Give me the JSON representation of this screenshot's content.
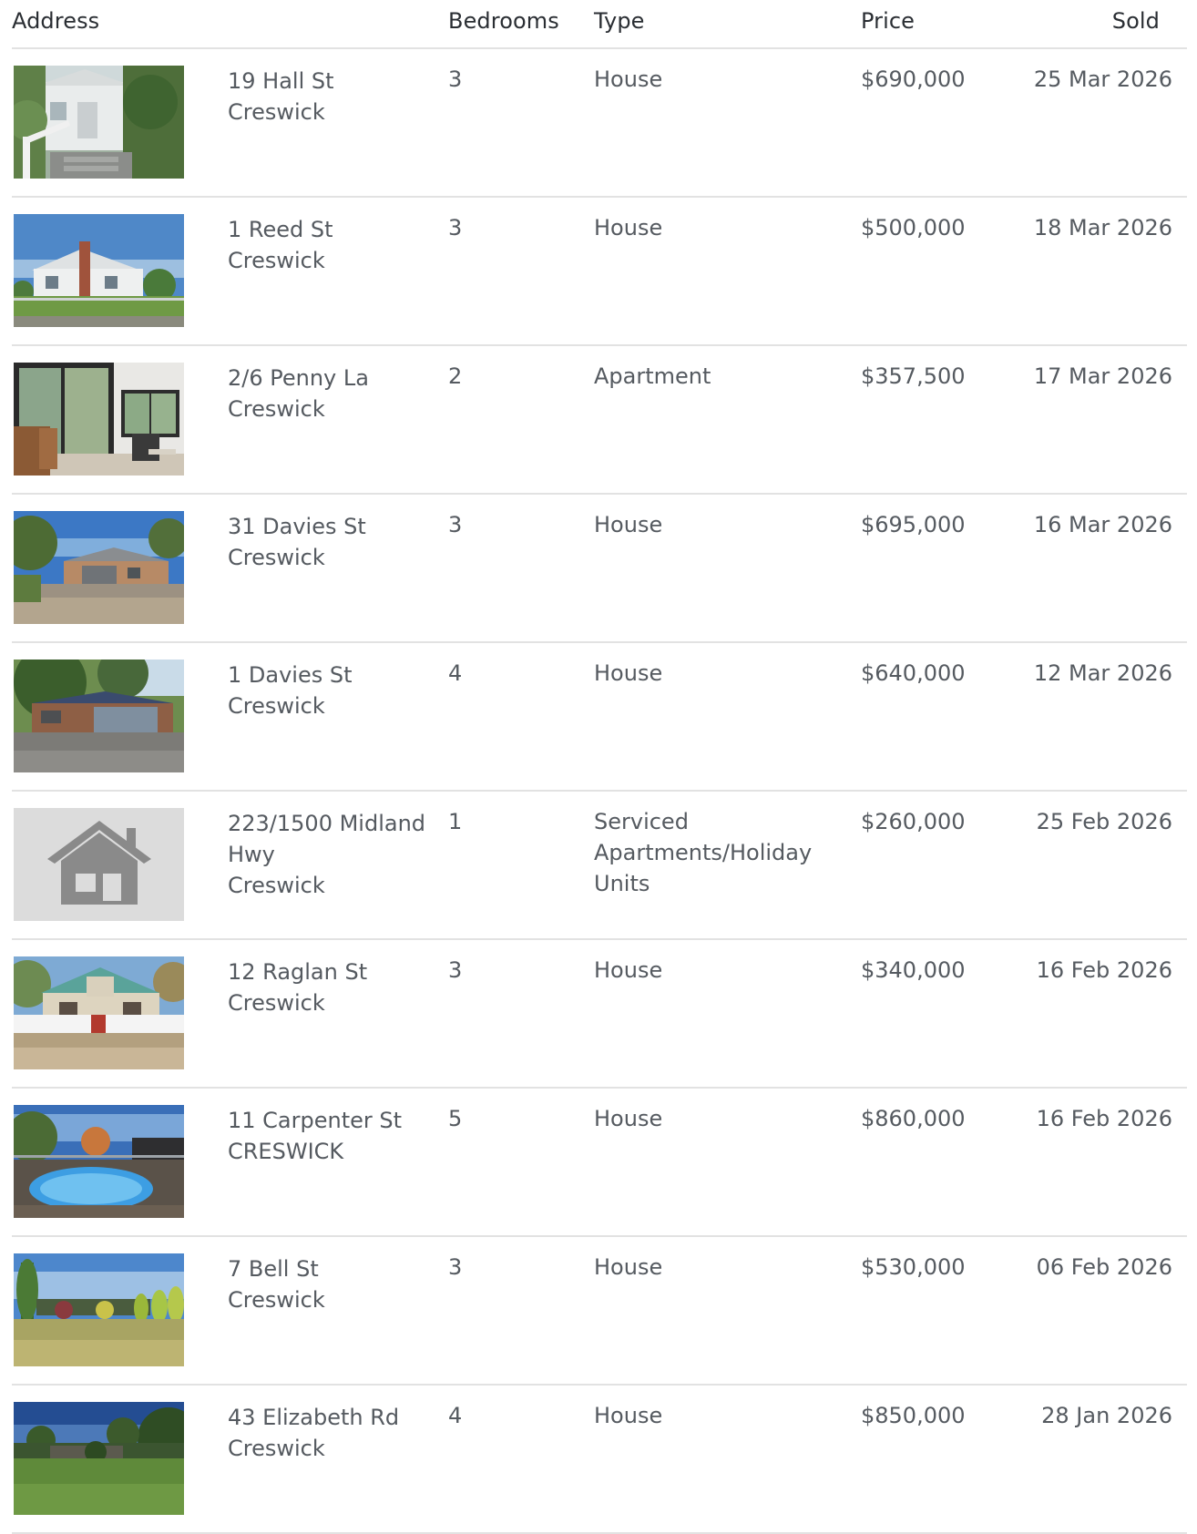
{
  "columns": {
    "address": "Address",
    "bedrooms": "Bedrooms",
    "type": "Type",
    "price": "Price",
    "sold": "Sold"
  },
  "rows": [
    {
      "street": "19 Hall St",
      "suburb": "Creswick",
      "bedrooms": "3",
      "type": "House",
      "price": "$690,000",
      "sold": "25 Mar 2026",
      "photo": "house-photo"
    },
    {
      "street": "1 Reed St",
      "suburb": "Creswick",
      "bedrooms": "3",
      "type": "House",
      "price": "$500,000",
      "sold": "18 Mar 2026",
      "photo": "house-photo"
    },
    {
      "street": "2/6 Penny La",
      "suburb": "Creswick",
      "bedrooms": "2",
      "type": "Apartment",
      "price": "$357,500",
      "sold": "17 Mar 2026",
      "photo": "interior-photo"
    },
    {
      "street": "31 Davies St",
      "suburb": "Creswick",
      "bedrooms": "3",
      "type": "House",
      "price": "$695,000",
      "sold": "16 Mar 2026",
      "photo": "house-photo"
    },
    {
      "street": "1 Davies St",
      "suburb": "Creswick",
      "bedrooms": "4",
      "type": "House",
      "price": "$640,000",
      "sold": "12 Mar 2026",
      "photo": "house-photo"
    },
    {
      "street": "223/1500 Midland Hwy",
      "suburb": "Creswick",
      "bedrooms": "1",
      "type": "Serviced Apartments/Holiday Units",
      "price": "$260,000",
      "sold": "25 Feb 2026",
      "photo": "placeholder-house-icon"
    },
    {
      "street": "12 Raglan St",
      "suburb": "Creswick",
      "bedrooms": "3",
      "type": "House",
      "price": "$340,000",
      "sold": "16 Feb 2026",
      "photo": "house-photo"
    },
    {
      "street": "11 Carpenter St",
      "suburb": "CRESWICK",
      "bedrooms": "5",
      "type": "House",
      "price": "$860,000",
      "sold": "16 Feb 2026",
      "photo": "pool-photo"
    },
    {
      "street": "7 Bell St",
      "suburb": "Creswick",
      "bedrooms": "3",
      "type": "House",
      "price": "$530,000",
      "sold": "06 Feb 2026",
      "photo": "garden-photo"
    },
    {
      "street": "43 Elizabeth Rd",
      "suburb": "Creswick",
      "bedrooms": "4",
      "type": "House",
      "price": "$850,000",
      "sold": "28 Jan 2026",
      "photo": "bushland-photo"
    }
  ],
  "colors": {
    "header_text": "#2a2e33",
    "body_text": "#555a60",
    "divider": "#e2e2e2",
    "placeholder_bg": "#dcdcdc",
    "placeholder_icon": "#8a8a8a"
  }
}
